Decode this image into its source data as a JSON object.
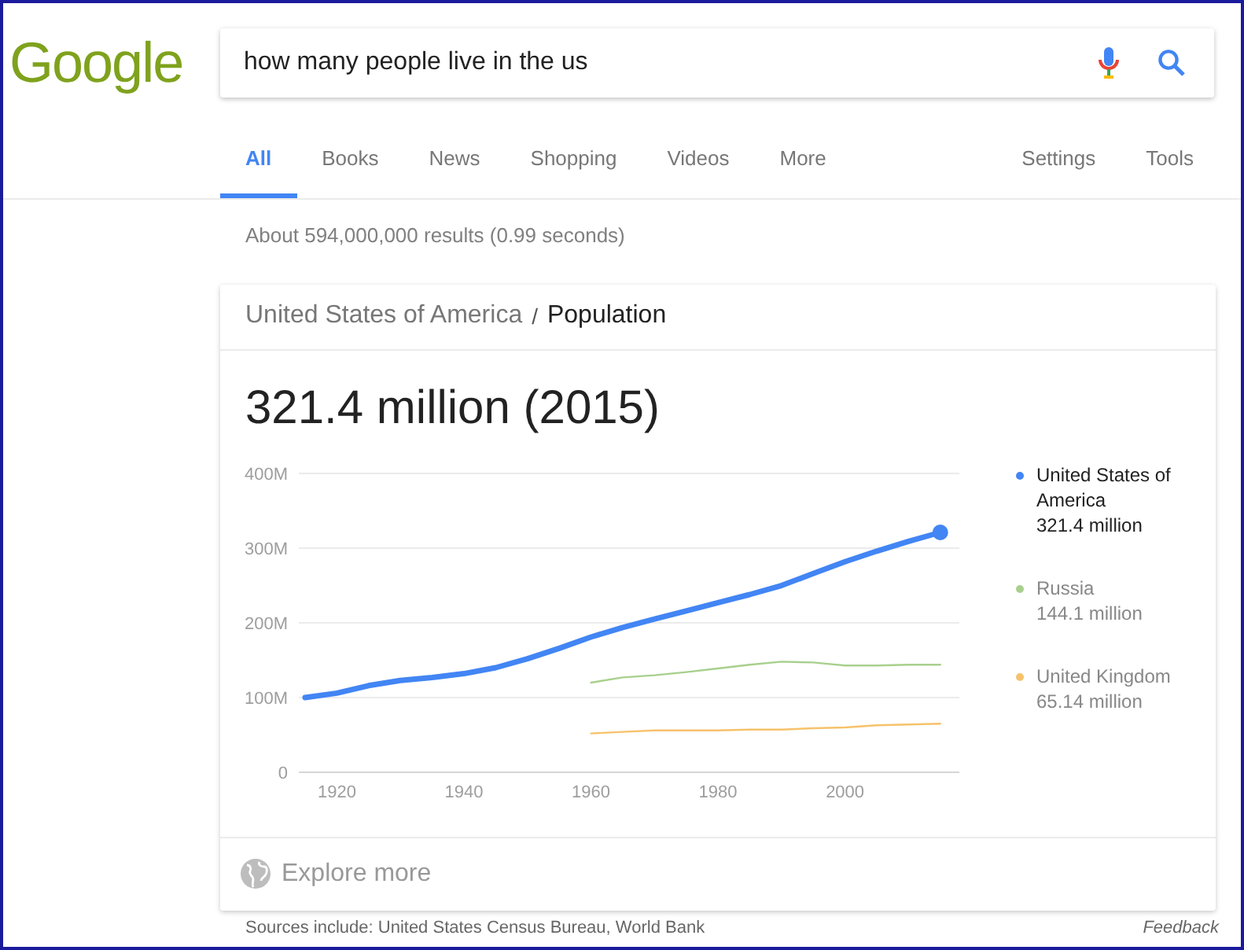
{
  "logo": {
    "text": "Google",
    "color": "#7fa21d"
  },
  "search": {
    "value": "how many people live in the us"
  },
  "tabs": [
    {
      "label": "All",
      "selected": true
    },
    {
      "label": "Books",
      "selected": false
    },
    {
      "label": "News",
      "selected": false
    },
    {
      "label": "Shopping",
      "selected": false
    },
    {
      "label": "Videos",
      "selected": false
    },
    {
      "label": "More",
      "selected": false
    }
  ],
  "tools": [
    "Settings",
    "Tools"
  ],
  "result_stats": "About 594,000,000 results (0.99 seconds)",
  "card": {
    "breadcrumb": [
      "United States of America",
      "Population"
    ],
    "separator": "/",
    "headline": "321.4 million (2015)",
    "chart_data": {
      "type": "line",
      "grid": true,
      "xlim": [
        1914,
        2018
      ],
      "x": [
        1915,
        1920,
        1925,
        1930,
        1935,
        1940,
        1945,
        1950,
        1955,
        1960,
        1965,
        1970,
        1975,
        1980,
        1985,
        1990,
        1995,
        2000,
        2005,
        2010,
        2015
      ],
      "xticks": [
        1920,
        1940,
        1960,
        1980,
        2000
      ],
      "yticks": [
        {
          "value": 0,
          "label": "0"
        },
        {
          "value": 100,
          "label": "100M"
        },
        {
          "value": 200,
          "label": "200M"
        },
        {
          "value": 300,
          "label": "300M"
        },
        {
          "value": 400,
          "label": "400M"
        }
      ],
      "ylim": [
        0,
        400
      ],
      "series": [
        {
          "name": "United States of America",
          "color": "#4285f4",
          "values": [
            100,
            106,
            116,
            123,
            127,
            132,
            140,
            152,
            166,
            181,
            194,
            205,
            216,
            227,
            238,
            250,
            266,
            282,
            296,
            309,
            321
          ]
        },
        {
          "name": "Russia",
          "color": "#a8d08d",
          "values": [
            null,
            null,
            null,
            null,
            null,
            null,
            null,
            null,
            null,
            120,
            127,
            130,
            134,
            139,
            144,
            148,
            147,
            143,
            143,
            144,
            144
          ]
        },
        {
          "name": "United Kingdom",
          "color": "#f6c26b",
          "values": [
            null,
            null,
            null,
            null,
            null,
            null,
            null,
            null,
            null,
            52,
            54,
            56,
            56,
            56,
            57,
            57,
            59,
            60,
            63,
            64,
            65
          ]
        }
      ]
    },
    "legend": [
      {
        "value": "321.4 million",
        "selected": true
      },
      {
        "value": "144.1 million",
        "selected": false
      },
      {
        "value": "65.14 million",
        "selected": false
      }
    ],
    "explore": "Explore more"
  },
  "footer": {
    "sources": "Sources include: United States Census Bureau, World Bank",
    "feedback": "Feedback"
  }
}
